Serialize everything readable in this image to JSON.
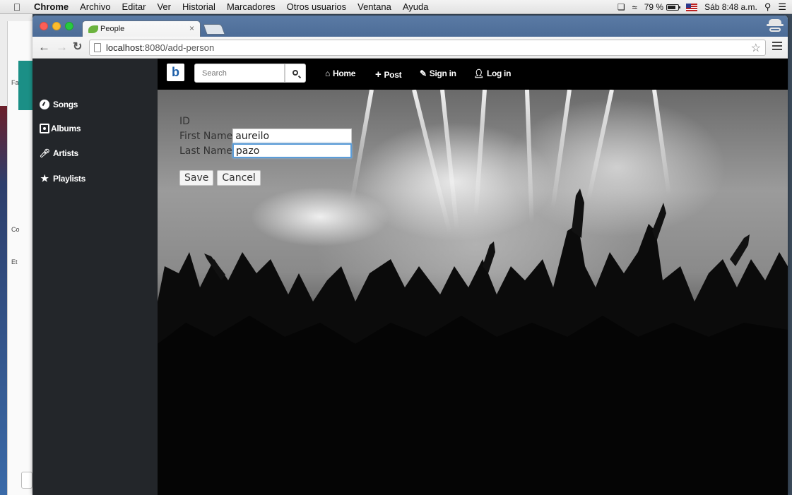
{
  "mac_menubar": {
    "app": "Chrome",
    "items": [
      "Archivo",
      "Editar",
      "Ver",
      "Historial",
      "Marcadores",
      "Otros usuarios",
      "Ventana",
      "Ayuda"
    ],
    "battery": "79 %",
    "clock": "Sáb 8:48 a.m."
  },
  "background_window": {
    "labels": [
      "Fa",
      "Co",
      "Et"
    ]
  },
  "browser": {
    "tab_title": "People",
    "tab_close": "×",
    "url_host": "localhost",
    "url_path": ":8080/add-person"
  },
  "navbar": {
    "brand": "b",
    "search_placeholder": "Search",
    "links": [
      {
        "label": "Home",
        "icon": "home-icon"
      },
      {
        "label": "Post",
        "icon": "plus-icon"
      },
      {
        "label": "Sign in",
        "icon": "edit-icon"
      },
      {
        "label": "Log in",
        "icon": "user-icon"
      }
    ]
  },
  "sidebar": {
    "items": [
      {
        "label": "Songs",
        "icon": "music-disc-icon"
      },
      {
        "label": "Albums",
        "icon": "album-icon"
      },
      {
        "label": "Artists",
        "icon": "microphone-icon"
      },
      {
        "label": "Playlists",
        "icon": "star-icon"
      }
    ]
  },
  "form": {
    "id_label": "ID",
    "first_name_label": "First Name",
    "first_name_value": "aureilo",
    "last_name_label": "Last Name",
    "last_name_value": "pazo",
    "save_label": "Save",
    "cancel_label": "Cancel"
  },
  "colors": {
    "sidebar_bg": "#23262a",
    "navbar_bg": "#000000",
    "focus_ring": "#5b9dd9",
    "brand_blue": "#1c5ea8"
  }
}
